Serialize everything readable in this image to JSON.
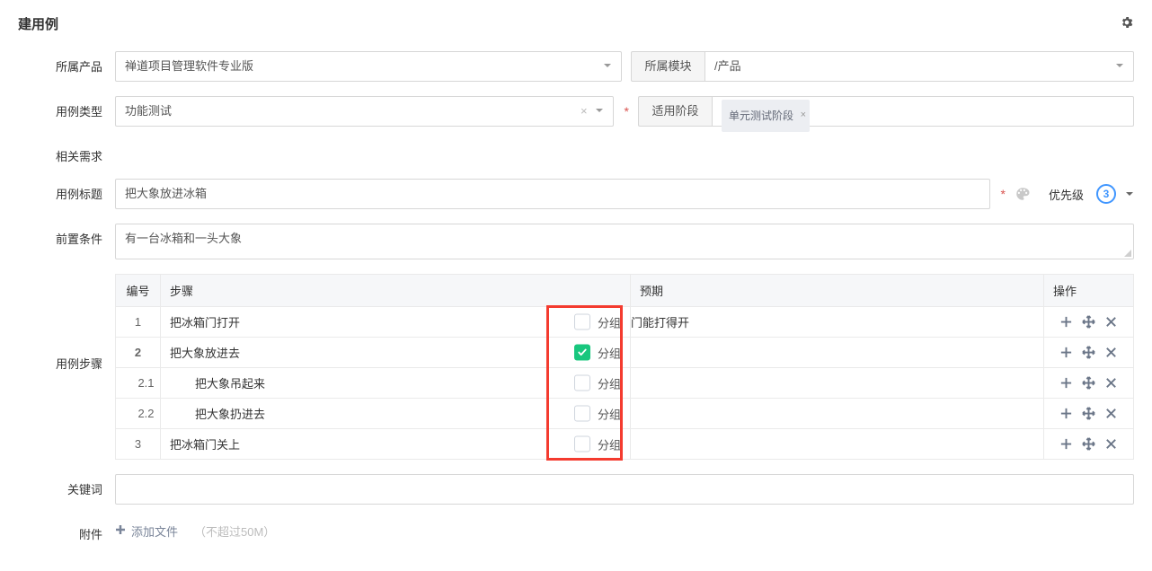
{
  "header": {
    "title": "建用例"
  },
  "labels": {
    "product": "所属产品",
    "caseType": "用例类型",
    "relatedReq": "相关需求",
    "caseTitle": "用例标题",
    "precondition": "前置条件",
    "steps": "用例步骤",
    "keywords": "关键词",
    "attachment": "附件",
    "module": "所属模块",
    "stage": "适用阶段",
    "priority": "优先级",
    "columns": {
      "num": "编号",
      "step": "步骤",
      "expected": "预期",
      "action": "操作"
    },
    "group": "分组",
    "addFile": "添加文件",
    "fileNote": "（不超过50M）"
  },
  "values": {
    "product": "禅道项目管理软件专业版",
    "caseType": "功能测试",
    "module": "/产品",
    "stageTag": "单元测试阶段",
    "title": "把大象放进冰箱",
    "precondition": "有一台冰箱和一头大象",
    "priority": "3"
  },
  "steps": [
    {
      "num": "1",
      "desc": "把冰箱门打开",
      "group": false,
      "sub": false,
      "expected": "门能打得开",
      "bold": false
    },
    {
      "num": "2",
      "desc": "把大象放进去",
      "group": true,
      "sub": false,
      "expected": "",
      "bold": true
    },
    {
      "num": "2.1",
      "desc": "把大象吊起来",
      "group": false,
      "sub": true,
      "expected": "",
      "bold": false
    },
    {
      "num": "2.2",
      "desc": "把大象扔进去",
      "group": false,
      "sub": true,
      "expected": "",
      "bold": false
    },
    {
      "num": "3",
      "desc": "把冰箱门关上",
      "group": false,
      "sub": false,
      "expected": "",
      "bold": false
    }
  ]
}
